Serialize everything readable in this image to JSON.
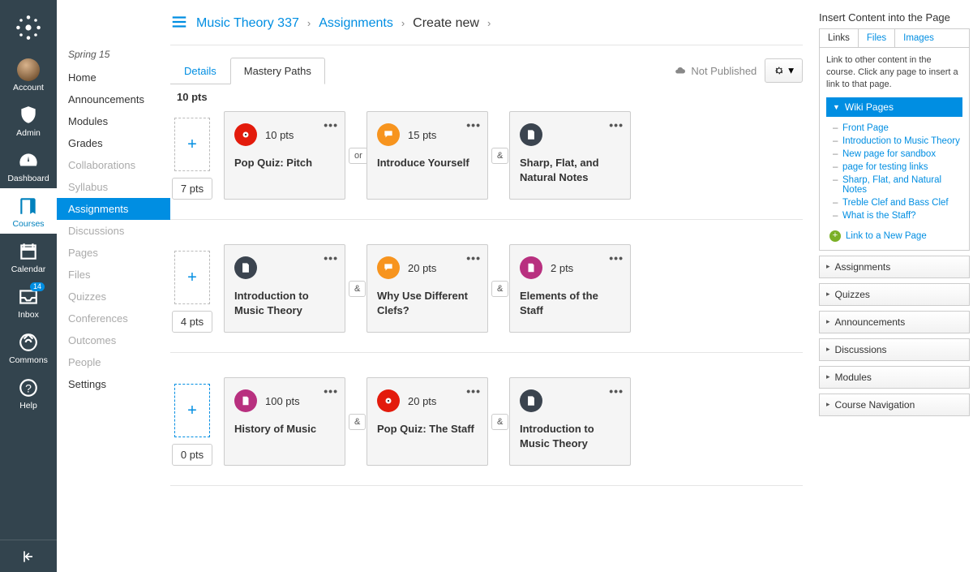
{
  "globalNav": {
    "items": [
      {
        "label": "Account"
      },
      {
        "label": "Admin"
      },
      {
        "label": "Dashboard"
      },
      {
        "label": "Courses"
      },
      {
        "label": "Calendar"
      },
      {
        "label": "Inbox",
        "badge": "14"
      },
      {
        "label": "Commons"
      },
      {
        "label": "Help"
      }
    ]
  },
  "breadcrumb": {
    "course": "Music Theory 337",
    "section": "Assignments",
    "current": "Create new"
  },
  "courseNav": {
    "term": "Spring 15",
    "items": [
      {
        "label": "Home",
        "state": ""
      },
      {
        "label": "Announcements",
        "state": ""
      },
      {
        "label": "Modules",
        "state": ""
      },
      {
        "label": "Grades",
        "state": ""
      },
      {
        "label": "Collaborations",
        "state": "disabled"
      },
      {
        "label": "Syllabus",
        "state": "disabled"
      },
      {
        "label": "Assignments",
        "state": "active"
      },
      {
        "label": "Discussions",
        "state": "disabled"
      },
      {
        "label": "Pages",
        "state": "disabled"
      },
      {
        "label": "Files",
        "state": "disabled"
      },
      {
        "label": "Quizzes",
        "state": "disabled"
      },
      {
        "label": "Conferences",
        "state": "disabled"
      },
      {
        "label": "Outcomes",
        "state": "disabled"
      },
      {
        "label": "People",
        "state": "disabled"
      },
      {
        "label": "Settings",
        "state": ""
      }
    ]
  },
  "tabs": {
    "details": "Details",
    "mastery": "Mastery Paths"
  },
  "publish": {
    "label": "Not Published"
  },
  "mastery": {
    "top_pts": "10 pts",
    "rows": [
      {
        "range_low": "7 pts",
        "cards": [
          {
            "icon": "quiz",
            "color": "red",
            "pts": "10 pts",
            "title": "Pop Quiz: Pitch"
          },
          {
            "join": "or"
          },
          {
            "icon": "discussion",
            "color": "orange",
            "pts": "15 pts",
            "title": "Introduce Yourself"
          },
          {
            "join": "&"
          },
          {
            "icon": "page",
            "color": "dark",
            "pts": "",
            "title": "Sharp, Flat, and Natural Notes"
          }
        ]
      },
      {
        "range_low": "4 pts",
        "cards": [
          {
            "icon": "page",
            "color": "dark",
            "pts": "",
            "title": "Introduction to Music Theory"
          },
          {
            "join": "&"
          },
          {
            "icon": "discussion",
            "color": "orange",
            "pts": "20 pts",
            "title": "Why Use Different Clefs?"
          },
          {
            "join": "&"
          },
          {
            "icon": "assignment",
            "color": "magenta",
            "pts": "2 pts",
            "title": "Elements of the Staff"
          }
        ]
      },
      {
        "range_low": "0 pts",
        "selected": true,
        "cards": [
          {
            "icon": "assignment",
            "color": "magenta",
            "pts": "100 pts",
            "title": "History of Music"
          },
          {
            "join": "&"
          },
          {
            "icon": "quiz",
            "color": "red",
            "pts": "20 pts",
            "title": "Pop Quiz: The Staff"
          },
          {
            "join": "&"
          },
          {
            "icon": "page",
            "color": "dark",
            "pts": "",
            "title": "Introduction to Music Theory"
          }
        ]
      }
    ]
  },
  "sidebar": {
    "title": "Insert Content into the Page",
    "tabs": {
      "links": "Links",
      "files": "Files",
      "images": "Images"
    },
    "desc": "Link to other content in the course. Click any page to insert a link to that page.",
    "wiki_head": "Wiki Pages",
    "wiki_pages": [
      "Front Page",
      "Introduction to Music Theory",
      "New page for sandbox",
      "page for testing links",
      "Sharp, Flat, and Natural Notes",
      "Treble Clef and Bass Clef",
      "What is the Staff?"
    ],
    "new_page": "Link to a New Page",
    "accordions": [
      "Assignments",
      "Quizzes",
      "Announcements",
      "Discussions",
      "Modules",
      "Course Navigation"
    ]
  }
}
